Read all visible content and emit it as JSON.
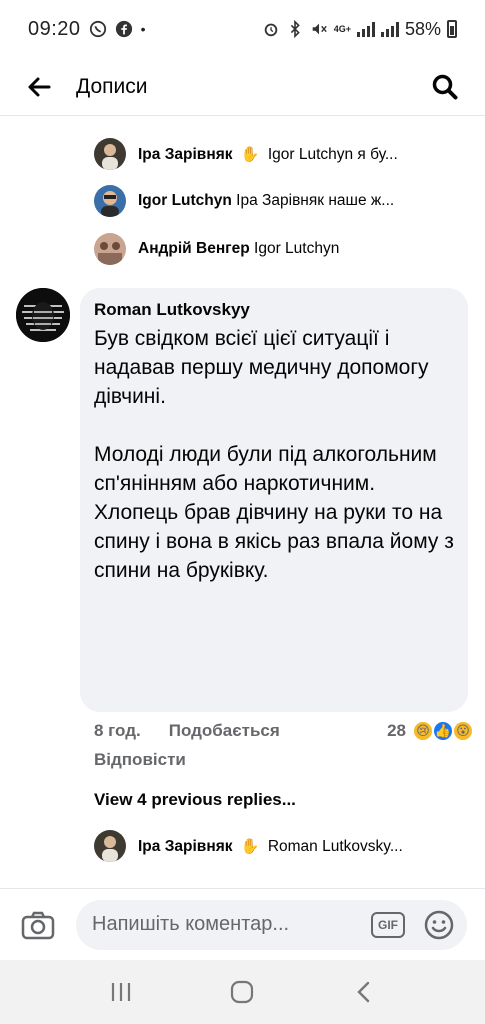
{
  "status_bar": {
    "time": "09:20",
    "network": "4G+",
    "battery": "58%"
  },
  "header": {
    "title": "Дописи"
  },
  "replies": [
    {
      "author": "Іра Зарівняк",
      "snippet": "Igor Lutchyn я бу...",
      "has_wave": true,
      "avatar_color": "#6b5a45"
    },
    {
      "author": "Igor Lutchyn",
      "snippet": "Іра Зарівняк наше ж...",
      "has_wave": false,
      "avatar_color": "#4a7bb0"
    },
    {
      "author": "Андрій Венгер",
      "snippet": "Igor Lutchyn",
      "has_wave": false,
      "avatar_color": "#b07b6a"
    }
  ],
  "comment": {
    "author": "Roman Lutkovskyy",
    "body": "Був свідком всієї цієї ситуації і надавав першу медичну допомогу дівчині.\n\nМолоді люди були під алкогольним сп'янінням або наркотичним.\nХлопець брав дівчину на руки то на спину і вона в якісь раз впала йому з спини на бруківку.",
    "time": "8 год.",
    "like_label": "Подобається",
    "reaction_count": "28",
    "reply_label": "Відповісти"
  },
  "previous_replies": "View 4 previous replies...",
  "last_reply": {
    "author": "Іра Зарівняк",
    "snippet": "Roman Lutkovsky...",
    "has_wave": true
  },
  "composer": {
    "placeholder": "Напишіть коментар...",
    "gif_label": "GIF"
  },
  "colors": {
    "bubble_bg": "#f0f2f5",
    "secondary_text": "#65676b",
    "accent": "#1877f2"
  }
}
